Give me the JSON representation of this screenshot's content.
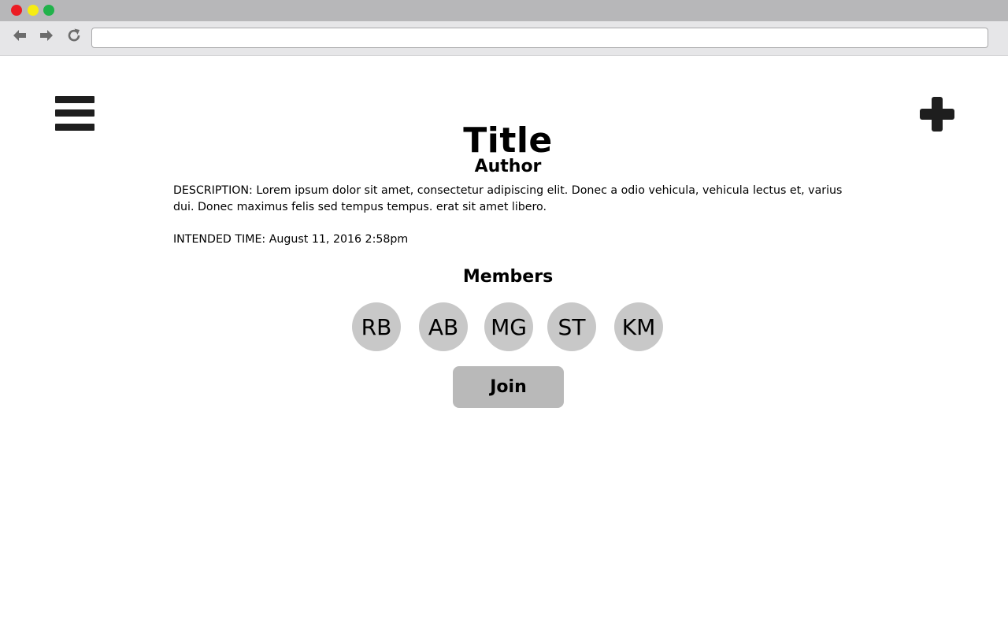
{
  "window": {
    "traffic_lights": [
      {
        "name": "close",
        "color": "#ec1c24"
      },
      {
        "name": "minimize",
        "color": "#f6ec13"
      },
      {
        "name": "maximize",
        "color": "#21b24b"
      }
    ]
  },
  "toolbar": {
    "back_icon": "arrow-left-icon",
    "forward_icon": "arrow-right-icon",
    "reload_icon": "reload-icon",
    "address_value": ""
  },
  "header": {
    "menu_icon": "hamburger-menu-icon",
    "add_icon": "plus-icon"
  },
  "event": {
    "title": "Title",
    "author": "Author",
    "description_label": "DESCRIPTION",
    "description_text": ": Lorem ipsum dolor sit amet, consectetur adipiscing elit. Donec a odio vehicula, vehicula lectus et, varius dui. Donec maximus felis sed tempus tempus. erat sit amet libero.",
    "intended_time_label": "INTENDED TIME",
    "intended_time_value": ": August 11, 2016 2:58pm"
  },
  "members": {
    "heading": "Members",
    "list": [
      {
        "initials": "RB"
      },
      {
        "initials": "AB"
      },
      {
        "initials": "MG"
      },
      {
        "initials": "ST"
      },
      {
        "initials": "KM"
      }
    ]
  },
  "actions": {
    "join_label": "Join"
  },
  "colors": {
    "avatar_bg": "#c8c8c8",
    "button_bg": "#b9b9b9",
    "icon_dark": "#1e1e1e"
  }
}
